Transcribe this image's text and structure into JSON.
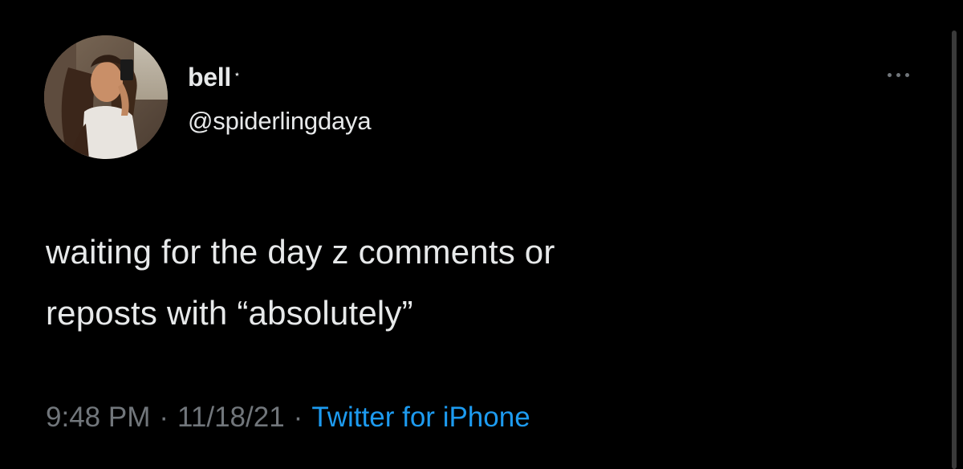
{
  "tweet": {
    "display_name": "bell",
    "name_emoji": "⋆",
    "handle": "@spiderlingdaya",
    "text": "waiting for the day z comments or\nreposts with “absolutely”",
    "time": "9:48 PM",
    "separator": "·",
    "date": "11/18/21",
    "source": "Twitter for iPhone"
  },
  "icons": {
    "avatar": "profile-photo",
    "more": "more-horizontal-icon"
  },
  "colors": {
    "background": "#000000",
    "primary_text": "#e7e9ea",
    "secondary_text": "#71767b",
    "link": "#1d9bf0"
  }
}
